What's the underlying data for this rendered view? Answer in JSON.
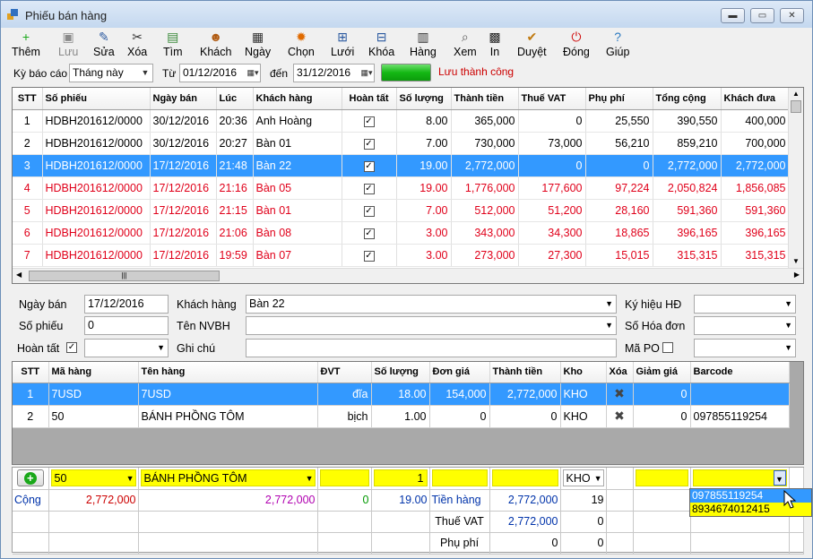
{
  "window": {
    "title": "Phiếu bán hàng"
  },
  "toolbar": [
    {
      "label": "Thêm",
      "icon": "add-icon",
      "glyph": "+",
      "color": "#1aa81a",
      "disabled": false
    },
    {
      "label": "Lưu",
      "icon": "save-icon",
      "glyph": "▣",
      "color": "#8a8a8a",
      "disabled": true
    },
    {
      "label": "Sửa",
      "icon": "pencil-icon",
      "glyph": "✎",
      "color": "#2c5aa0",
      "disabled": false
    },
    {
      "label": "Xóa",
      "icon": "delete-icon",
      "glyph": "✂",
      "color": "#333333",
      "disabled": false
    },
    {
      "label": "Tìm",
      "icon": "search-icon",
      "glyph": "▤",
      "color": "#3a8a3a",
      "disabled": false
    },
    {
      "label": "Khách",
      "icon": "customer-icon",
      "glyph": "☻",
      "color": "#b05a10",
      "disabled": false
    },
    {
      "label": "Ngày",
      "icon": "calendar-icon",
      "glyph": "▦",
      "color": "#333333",
      "disabled": false
    },
    {
      "label": "Chọn",
      "icon": "gear-icon",
      "glyph": "✹",
      "color": "#e06a00",
      "disabled": false
    },
    {
      "label": "Lưới",
      "icon": "grid-icon",
      "glyph": "⊞",
      "color": "#2c5aa0",
      "disabled": false
    },
    {
      "label": "Khóa",
      "icon": "lock-icon",
      "glyph": "⊟",
      "color": "#2c5aa0",
      "disabled": false
    },
    {
      "label": "Hàng",
      "icon": "goods-icon",
      "glyph": "▥",
      "color": "#333333",
      "disabled": false
    },
    {
      "label": "Xem",
      "icon": "preview-icon",
      "glyph": "⌕",
      "color": "#555555",
      "disabled": false
    },
    {
      "label": "In",
      "icon": "printer-icon",
      "glyph": "▩",
      "color": "#222222",
      "disabled": false
    },
    {
      "label": "Duyệt",
      "icon": "approve-icon",
      "glyph": "✔",
      "color": "#c07a10",
      "disabled": false
    },
    {
      "label": "Đóng",
      "icon": "power-icon",
      "glyph": "⏻",
      "color": "#d01010",
      "disabled": false
    },
    {
      "label": "Giúp",
      "icon": "help-icon",
      "glyph": "?",
      "color": "#2c7ac0",
      "disabled": false
    }
  ],
  "filter": {
    "period_label": "Kỳ báo cáo",
    "period_value": "Tháng này",
    "from_label": "Từ",
    "from_date": "01/12/2016",
    "to_label": "đến",
    "to_date": "31/12/2016",
    "status_text": "Lưu thành công"
  },
  "invoices": {
    "columns": [
      "STT",
      "Số phiếu",
      "Ngày bán",
      "Lúc",
      "Khách hàng",
      "Hoàn tất",
      "Số lượng",
      "Thành tiền",
      "Thuế VAT",
      "Phụ phí",
      "Tổng cộng",
      "Khách đưa"
    ],
    "rows": [
      {
        "stt": "1",
        "so_phieu": "HDBH201612/0000",
        "ngay": "30/12/2016",
        "luc": "20:36",
        "khach": "Anh Hoàng",
        "so_luong": "8.00",
        "thanh_tien": "365,000",
        "vat": "0",
        "phu_phi": "25,550",
        "tong": "390,550",
        "khach_dua": "400,000",
        "style": "normal"
      },
      {
        "stt": "2",
        "so_phieu": "HDBH201612/0000",
        "ngay": "30/12/2016",
        "luc": "20:27",
        "khach": "Bàn 01",
        "so_luong": "7.00",
        "thanh_tien": "730,000",
        "vat": "73,000",
        "phu_phi": "56,210",
        "tong": "859,210",
        "khach_dua": "700,000",
        "style": "normal"
      },
      {
        "stt": "3",
        "so_phieu": "HDBH201612/0000",
        "ngay": "17/12/2016",
        "luc": "21:48",
        "khach": "Bàn 22",
        "so_luong": "19.00",
        "thanh_tien": "2,772,000",
        "vat": "0",
        "phu_phi": "0",
        "tong": "2,772,000",
        "khach_dua": "2,772,000",
        "style": "sel"
      },
      {
        "stt": "4",
        "so_phieu": "HDBH201612/0000",
        "ngay": "17/12/2016",
        "luc": "21:16",
        "khach": "Bàn 05",
        "so_luong": "19.00",
        "thanh_tien": "1,776,000",
        "vat": "177,600",
        "phu_phi": "97,224",
        "tong": "2,050,824",
        "khach_dua": "1,856,085",
        "style": "red"
      },
      {
        "stt": "5",
        "so_phieu": "HDBH201612/0000",
        "ngay": "17/12/2016",
        "luc": "21:15",
        "khach": "Bàn 01",
        "so_luong": "7.00",
        "thanh_tien": "512,000",
        "vat": "51,200",
        "phu_phi": "28,160",
        "tong": "591,360",
        "khach_dua": "591,360",
        "style": "red"
      },
      {
        "stt": "6",
        "so_phieu": "HDBH201612/0000",
        "ngay": "17/12/2016",
        "luc": "21:06",
        "khach": "Bàn 08",
        "so_luong": "3.00",
        "thanh_tien": "343,000",
        "vat": "34,300",
        "phu_phi": "18,865",
        "tong": "396,165",
        "khach_dua": "396,165",
        "style": "red"
      },
      {
        "stt": "7",
        "so_phieu": "HDBH201612/0000",
        "ngay": "17/12/2016",
        "luc": "19:59",
        "khach": "Bàn 07",
        "so_luong": "3.00",
        "thanh_tien": "273,000",
        "vat": "27,300",
        "phu_phi": "15,015",
        "tong": "315,315",
        "khach_dua": "315,315",
        "style": "red"
      }
    ]
  },
  "form": {
    "ngay_ban_label": "Ngày bán",
    "ngay_ban": "17/12/2016",
    "khach_hang_label": "Khách hàng",
    "khach_hang": "Bàn 22",
    "ky_hieu_label": "Ký hiệu HĐ",
    "so_phieu_label": "Số phiếu",
    "so_phieu": "0",
    "ten_nvbh_label": "Tên NVBH",
    "so_hoa_don_label": "Số Hóa đơn",
    "hoan_tat_label": "Hoàn tất",
    "ghi_chu_label": "Ghi chú",
    "ma_po_label": "Mã PO"
  },
  "details": {
    "columns": [
      "STT",
      "Mã hàng",
      "Tên hàng",
      "ĐVT",
      "Số lượng",
      "Đơn giá",
      "Thành tiền",
      "Kho",
      "Xóa",
      "Giảm giá",
      "Barcode"
    ],
    "rows": [
      {
        "stt": "1",
        "ma": "7USD",
        "ten": "7USD",
        "dvt": "đĩa",
        "so_luong": "18.00",
        "don_gia": "154,000",
        "thanh_tien": "2,772,000",
        "kho": "KHO",
        "giam_gia": "0",
        "barcode": ""
      },
      {
        "stt": "2",
        "ma": "50",
        "ten": "BÁNH PHỒNG TÔM",
        "dvt": "bịch",
        "so_luong": "1.00",
        "don_gia": "0",
        "thanh_tien": "0",
        "kho": "KHO",
        "giam_gia": "0",
        "barcode": "097855119254"
      }
    ]
  },
  "entry": {
    "ma": "50",
    "ten": "BÁNH PHỒNG TÔM",
    "so_luong": "1",
    "kho": "KHO",
    "barcode_options": [
      "097855119254",
      "8934674012415"
    ]
  },
  "totals": {
    "cong_label": "Cộng",
    "cong_amount": "2,772,000",
    "cong_amount2": "2,772,000",
    "cong_zero": "0",
    "cong_qty": "19.00",
    "tien_hang_label": "Tiền hàng",
    "tien_hang": "2,772,000",
    "tien_hang_count": "19",
    "thue_vat_label": "Thuế VAT",
    "thue_vat": "2,772,000",
    "thue_vat_extra": "0",
    "phu_phi_label": "Phụ phí",
    "phu_phi": "0",
    "phu_phi_extra": "0"
  }
}
